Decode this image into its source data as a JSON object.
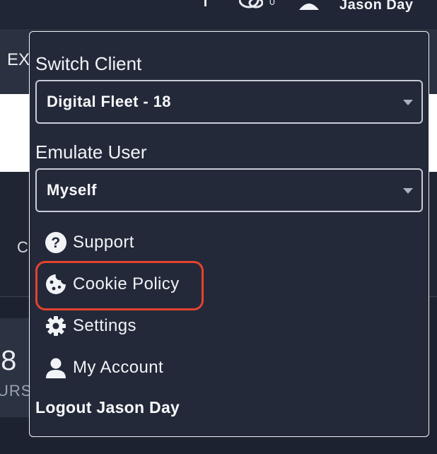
{
  "header": {
    "chat_count": "0",
    "user_name": "Jason Day"
  },
  "background": {
    "section_label_partial": "EX",
    "row_label_partial": "C",
    "stat_value_partial": ".8",
    "stat_label_partial": "URS"
  },
  "menu": {
    "switch_client_label": "Switch Client",
    "switch_client_value": "Digital Fleet - 18",
    "emulate_user_label": "Emulate User",
    "emulate_user_value": "Myself",
    "items": [
      {
        "label": "Support",
        "icon": "question-circle-icon"
      },
      {
        "label": "Cookie Policy",
        "icon": "cookie-icon"
      },
      {
        "label": "Settings",
        "icon": "gear-icon"
      },
      {
        "label": "My Account",
        "icon": "user-icon"
      }
    ],
    "logout_label": "Logout Jason Day"
  },
  "colors": {
    "menu_background": "#232939",
    "highlight": "#e4432d",
    "text": "#f1f3f6"
  }
}
